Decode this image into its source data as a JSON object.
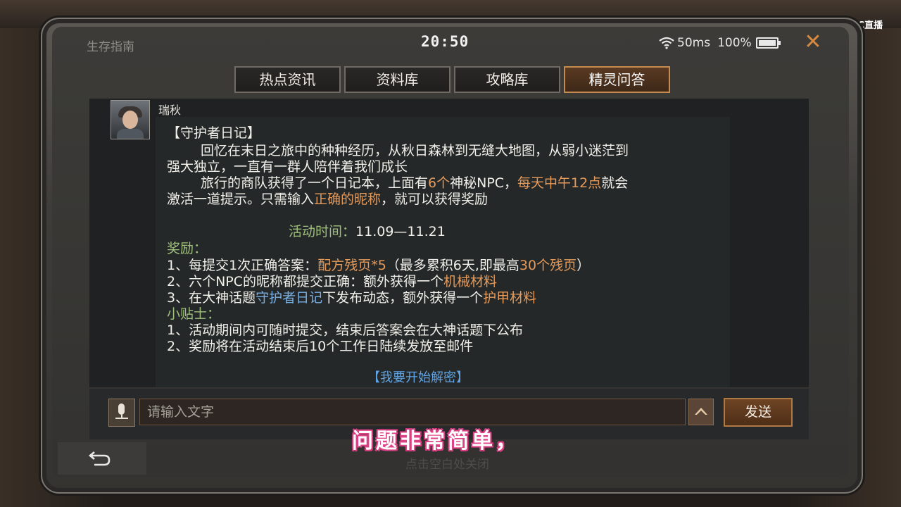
{
  "app": {
    "title": "生存指南",
    "clock": "20:50"
  },
  "status": {
    "ping": "50ms",
    "battery": "100%"
  },
  "tabs": [
    {
      "label": "热点资讯",
      "active": false
    },
    {
      "label": "资料库",
      "active": false
    },
    {
      "label": "攻略库",
      "active": false
    },
    {
      "label": "精灵问答",
      "active": true
    }
  ],
  "message": {
    "sender": "瑞秋",
    "title": "【守护者日记】",
    "p1_line1": "回忆在末日之旅中的种种经历，从秋日森林到无缝大地图，从弱小迷茫到",
    "p1_line2": "强大独立，一直有一群人陪伴着我们成长",
    "p2_a": "旅行的商队获得了一个日记本，上面有",
    "p2_b": "6个",
    "p2_c": "神秘NPC，",
    "p2_d": "每天中午12点",
    "p2_e": "就会",
    "p2_line2_a": "激活一道提示。只需输入",
    "p2_line2_b": "正确的昵称",
    "p2_line2_c": "，就可以获得奖励",
    "event_time_label": "活动时间：",
    "event_time_value": "11.09—11.21",
    "reward_heading": "奖励：",
    "r1_a": "1、每提交1次正确答案：",
    "r1_b": "配方残页*5",
    "r1_c": "（最多累积6天,即最高",
    "r1_d": "30个残页",
    "r1_e": "）",
    "r2_a": "2、六个NPC的昵称都提交正确：额外获得一个",
    "r2_b": "机械材料",
    "r3_a": "3、在大神话题",
    "r3_b": "守护者日记",
    "r3_c": "下发布动态，额外获得一个",
    "r3_d": "护甲材料",
    "tips_heading": "小贴士：",
    "t1": "1、活动期间内可随时提交，结束后答案会在大神话题下公布",
    "t2": "2、奖励将在活动结束后10个工作日陆续发放至邮件",
    "link": "【我要开始解密】"
  },
  "input": {
    "placeholder": "请输入文字",
    "value": "",
    "send_label": "发送"
  },
  "bottom": {
    "hint": "点击空白处关闭"
  },
  "overlay": {
    "subtitle": "问题非常简单，",
    "watermark": "CC直播"
  },
  "colors": {
    "accent_orange": "#e59a5a",
    "link_blue": "#5ea4e5",
    "green": "#9fc07c",
    "tab_active": "#c58a4e"
  },
  "icons": [
    "wifi-icon",
    "battery-icon",
    "close-icon",
    "microphone-icon",
    "chevron-up-icon",
    "back-arrow-icon"
  ]
}
